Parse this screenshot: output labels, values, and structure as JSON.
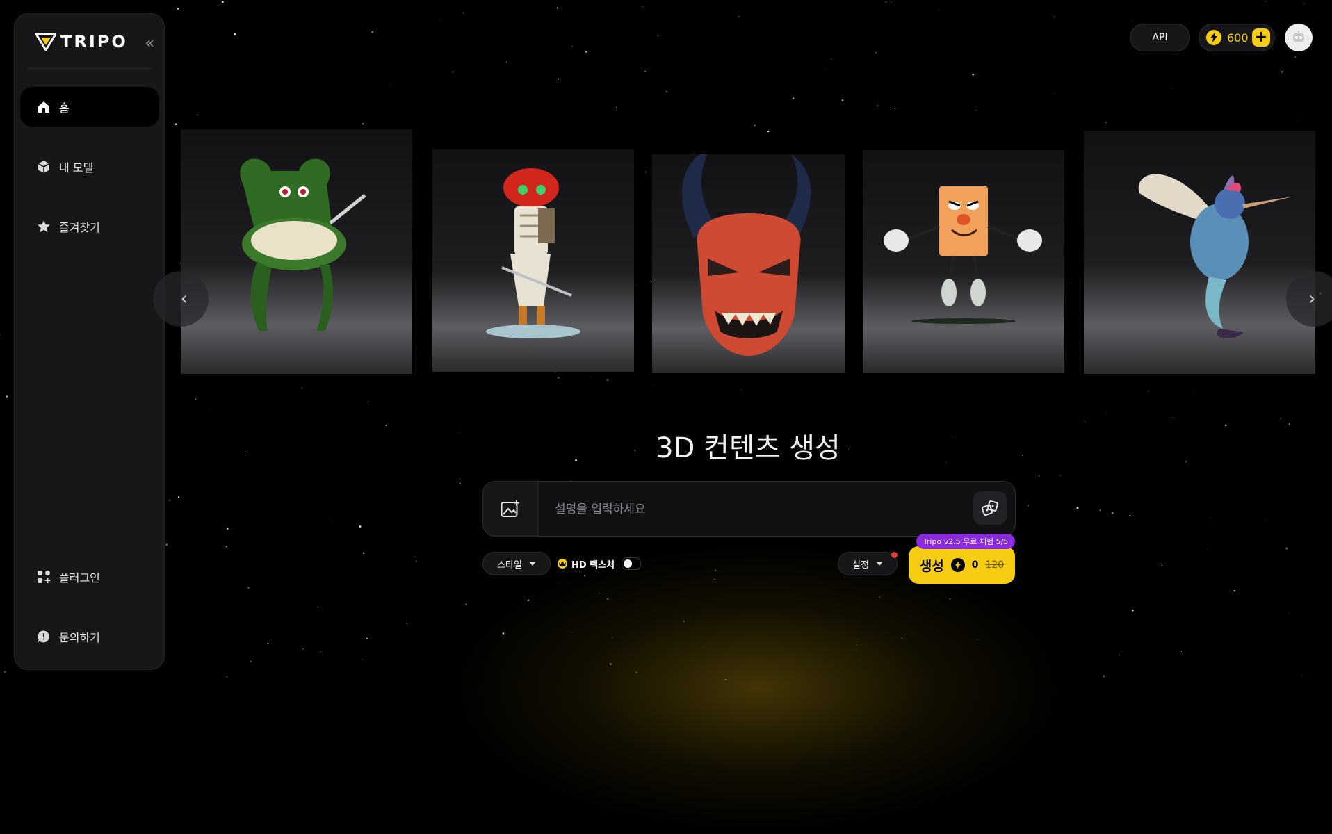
{
  "app": {
    "logo_text": "TRIPO"
  },
  "sidebar": {
    "collapse_icon": "double-chevron-left-icon",
    "items": [
      {
        "label": "홈",
        "icon": "home-icon",
        "active": true
      },
      {
        "label": "내 모델",
        "icon": "cube-icon"
      },
      {
        "label": "즐겨찾기",
        "icon": "star-icon"
      }
    ],
    "bottom_items": [
      {
        "label": "플러그인",
        "icon": "plugin-icon"
      },
      {
        "label": "문의하기",
        "icon": "chat-icon"
      }
    ]
  },
  "header": {
    "api_label": "API",
    "credits": "600",
    "add_credits_label": "+",
    "accent_color": "#f6cd12"
  },
  "carousel": {
    "cards": [
      {
        "name": "green-cereal-chair-model"
      },
      {
        "name": "red-skeleton-robot-model"
      },
      {
        "name": "red-oni-mask-model"
      },
      {
        "name": "orange-cartoon-character-model"
      },
      {
        "name": "hummingbird-model"
      }
    ],
    "prev_icon": "chevron-left-icon",
    "next_icon": "chevron-right-icon"
  },
  "main": {
    "title": "3D 컨텐츠 생성",
    "prompt_placeholder": "설명을 입력하세요",
    "style_label": "스타일",
    "hd_texture_label": "HD 텍스처",
    "settings_label": "설정",
    "trial_badge": "Tripo v2.5 무료 체험 5/5",
    "generate_label": "생성",
    "generate_cost": "0",
    "generate_original_cost": "120",
    "badge_color": "#8a2be2"
  }
}
